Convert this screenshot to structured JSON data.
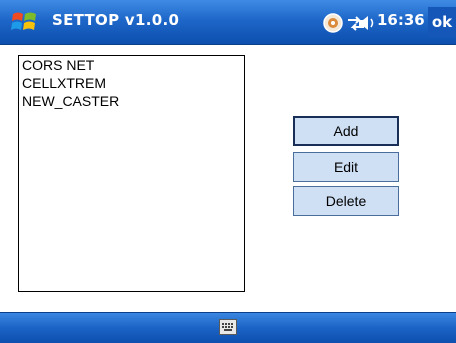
{
  "titlebar": {
    "title": "SETTOP v1.0.0",
    "clock": "16:36",
    "ok_label": "ok",
    "icons": [
      "windows-start-icon",
      "connectivity-icon",
      "network-sync-icon",
      "volume-icon"
    ]
  },
  "list": {
    "items": [
      "CORS NET",
      "CELLXTREM",
      "NEW_CASTER"
    ]
  },
  "buttons": {
    "add": "Add",
    "edit": "Edit",
    "delete": "Delete"
  },
  "bottombar": {
    "icons": [
      "keyboard-icon"
    ]
  },
  "colors": {
    "titlebar": "#1e67c9",
    "button_bg": "#cfe0f4",
    "button_border": "#4a6e9b"
  }
}
